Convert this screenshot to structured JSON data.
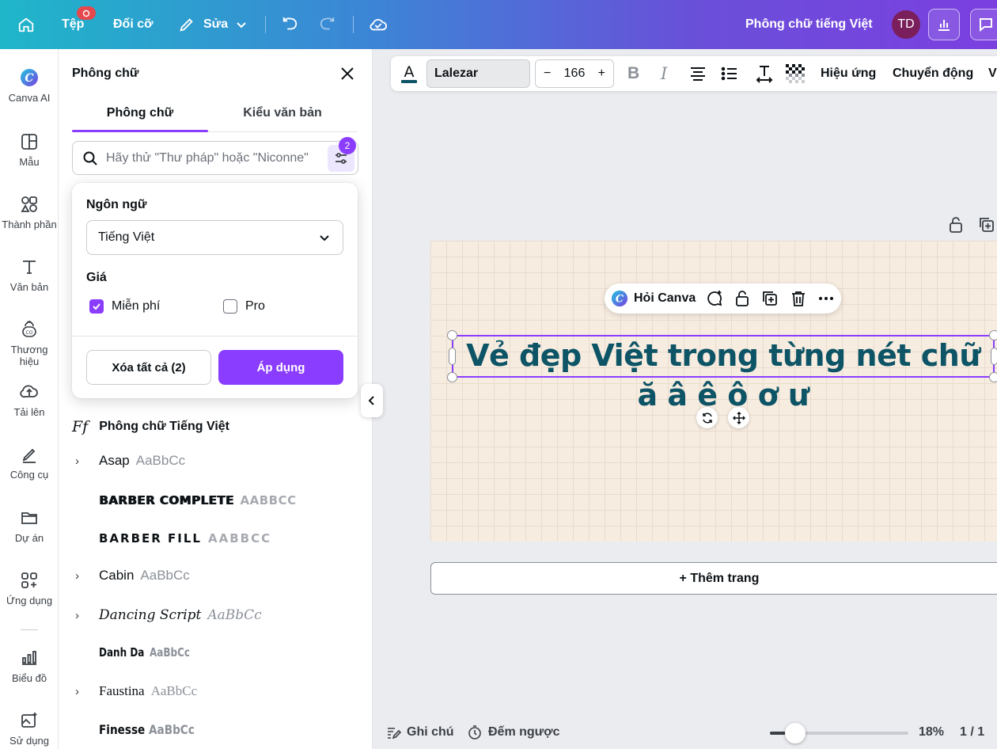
{
  "topbar": {
    "file_label": "Tệp",
    "file_badge": "",
    "resize_label": "Đổi cỡ",
    "edit_label": "Sửa",
    "design_title": "Phông chữ tiếng Việt",
    "avatar_initials": "TD"
  },
  "rail": {
    "items": [
      {
        "label": "Canva AI",
        "icon": "canva-ai-icon"
      },
      {
        "label": "Mẫu",
        "icon": "template-icon"
      },
      {
        "label": "Thành phần",
        "icon": "elements-icon"
      },
      {
        "label": "Văn bản",
        "icon": "text-icon"
      },
      {
        "label": "Thương hiệu",
        "icon": "brand-icon"
      },
      {
        "label": "Tải lên",
        "icon": "upload-icon"
      },
      {
        "label": "Công cụ",
        "icon": "tools-icon"
      },
      {
        "label": "Dự án",
        "icon": "folder-icon"
      },
      {
        "label": "Ứng dụng",
        "icon": "apps-icon"
      },
      {
        "label": "Biểu đồ",
        "icon": "chart-icon"
      },
      {
        "label": "Sử dụng M...",
        "icon": "magic-media-icon"
      }
    ]
  },
  "panel": {
    "title": "Phông chữ",
    "tabs": [
      "Phông chữ",
      "Kiểu văn bản"
    ],
    "search_placeholder": "Hãy thử \"Thư pháp\" hoặc \"Niconne\"",
    "filter_count": "2",
    "filter": {
      "language_label": "Ngôn ngữ",
      "language_value": "Tiếng Việt",
      "price_label": "Giá",
      "price_free": "Miễn phí",
      "price_pro": "Pro",
      "clear_button": "Xóa tất cả (2)",
      "apply_button": "Áp dụng"
    },
    "section_title": "Phông chữ Tiếng Việt",
    "fonts": [
      {
        "name": "Asap",
        "preview": "AaBbCc",
        "expandable": true
      },
      {
        "name": "BARBER COMPLETE",
        "preview": "AABBCC",
        "expandable": false
      },
      {
        "name": "BARBER FILL",
        "preview": "AABBCC",
        "expandable": false
      },
      {
        "name": "Cabin",
        "preview": "AaBbCc",
        "expandable": true
      },
      {
        "name": "Dancing Script",
        "preview": "AaBbCc",
        "expandable": true
      },
      {
        "name": "Danh Da",
        "preview": "AaBbCc",
        "expandable": false
      },
      {
        "name": "Faustina",
        "preview": "AaBbCc",
        "expandable": true
      },
      {
        "name": "Finesse",
        "preview": "AaBbCc",
        "expandable": false
      }
    ]
  },
  "text_toolbar": {
    "font_name": "Lalezar",
    "font_size": "166",
    "minus": "−",
    "plus": "+",
    "effects_label": "Hiệu ứng",
    "animate_label": "Chuyển động",
    "more_label": "V"
  },
  "canvas": {
    "ask_canva": "Hỏi Canva",
    "headline_line1": "Vẻ đẹp Việt trong từng nét chữ",
    "headline_line2": "ă â ê ô ơ ư",
    "headline_color": "#0d5466",
    "add_page": "+ Thêm trang"
  },
  "bottombar": {
    "notes_label": "Ghi chú",
    "timer_label": "Đếm ngược",
    "zoom_percent": "18%",
    "zoom_fraction": 0.18,
    "page_counter": "1 / 1"
  },
  "colors": {
    "accent": "#8b3dff",
    "page_bg": "#f7ece0"
  }
}
